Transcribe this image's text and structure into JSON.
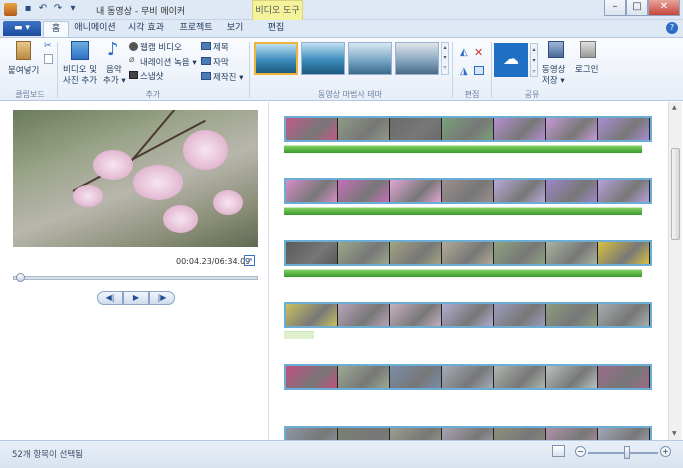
{
  "window": {
    "title": "내 동영상 - 무비 메이커",
    "context_tab": "비디오 도구",
    "controls": {
      "minimize": "–",
      "maximize": "□",
      "close": "✕"
    }
  },
  "quick_access": [
    "save-icon",
    "undo-icon",
    "redo-icon",
    "dropdown-icon"
  ],
  "file_button": "▬ ▾",
  "tabs": [
    {
      "label": "홈",
      "active": true
    },
    {
      "label": "애니메이션"
    },
    {
      "label": "시각 효과"
    },
    {
      "label": "프로젝트"
    },
    {
      "label": "보기"
    },
    {
      "label": "편집"
    }
  ],
  "ribbon": {
    "clipboard": {
      "paste": "붙여넣기",
      "group": "클립보드"
    },
    "add": {
      "add_video_photo_l1": "비디오 및",
      "add_video_photo_l2": "사진 추가",
      "add_music_l1": "음악",
      "add_music_l2": "추가 ▾",
      "webcam": "웹캠 비디오",
      "narration": "내레이션 녹음 ▾",
      "snapshot": "스냅샷",
      "title": "제목",
      "caption": "자막",
      "credits": "제작진 ▾",
      "group": "추가"
    },
    "themes": {
      "group": "동영상 마법사 테마",
      "count": 4
    },
    "editing": {
      "group": "편집"
    },
    "share": {
      "save_movie_l1": "동영상",
      "save_movie_l2": "저장 ▾",
      "sign_in": "로그인",
      "group": "공유"
    }
  },
  "player": {
    "timecode": "00:04.23/06:34.09",
    "seek_fraction": 0.012
  },
  "storyboard": {
    "rows": [
      {
        "frames": [
          "#c05a8a",
          "#8f9a86",
          "#6b6b6b",
          "#7aa07a",
          "#b48fd0",
          "#c59ad6",
          "#a98dd0"
        ],
        "audio": true
      },
      {
        "frames": [
          "#d48ec8",
          "#c46fb8",
          "#e0a6d5",
          "#9c8e8e",
          "#b7a9d8",
          "#9d86c8",
          "#b6a0d9"
        ],
        "audio": true
      },
      {
        "frames": [
          "#5a5a5a",
          "#9aa88a",
          "#a3a382",
          "#b0aa96",
          "#8ea37e",
          "#a9b4a0",
          "#d8c040"
        ],
        "audio": true
      },
      {
        "frames": [
          "#c8c060",
          "#b8a4b8",
          "#c8b0c0",
          "#b0acd0",
          "#9c9cbc",
          "#8e9c80",
          "#a6aeae"
        ],
        "audio": false
      },
      {
        "frames": [
          "#c25080",
          "#9caa90",
          "#7a8ca8",
          "#a4acb8",
          "#aeb6ae",
          "#b8c0c0",
          "#9c6a8a"
        ],
        "audio": false
      },
      {
        "frames": [
          "#8e96a4",
          "#7a8072",
          "#9a9e8e",
          "#a8a2b0",
          "#8c9078",
          "#b090a8",
          "#a0a8b8"
        ],
        "audio": false
      }
    ]
  },
  "status": {
    "text": "52개 항목이 선택됨",
    "zoom_out": "−",
    "zoom_in": "+"
  },
  "colors": {
    "accent": "#3b73c6",
    "selection_border": "#6aaed6",
    "audio_track": "#5cb443",
    "context_tab": "#f4f39b"
  }
}
